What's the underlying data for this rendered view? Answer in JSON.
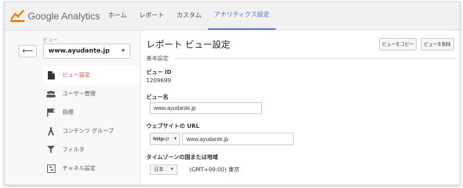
{
  "app": {
    "logo_text": "Google Analytics",
    "brand_color": "#f57c00"
  },
  "nav": {
    "items": [
      {
        "label": "ホーム"
      },
      {
        "label": "レポート"
      },
      {
        "label": "カスタム"
      },
      {
        "label": "アナリティクス設定"
      }
    ],
    "active_index": 3,
    "active_color": "#4a6bd4"
  },
  "sidebar": {
    "back_icon": "⟵",
    "view_label": "ビュー",
    "view_selected": "www.ayudante.jp",
    "items": [
      {
        "label": "ビュー設定",
        "icon": "document-icon"
      },
      {
        "label": "ユーザー管理",
        "icon": "users-icon"
      },
      {
        "label": "目標",
        "icon": "flag-icon"
      },
      {
        "label": "コンテンツ グループ",
        "icon": "person-walk-icon"
      },
      {
        "label": "フィルタ",
        "icon": "filter-icon"
      },
      {
        "label": "チャネル設定",
        "icon": "channel-icon"
      }
    ],
    "active_index": 0,
    "active_color": "#dd4b39"
  },
  "main": {
    "title": "レポート ビュー設定",
    "copy_button": "ビューをコピー",
    "delete_button": "ビューを削除",
    "section_title": "基本設定",
    "view_id_label": "ビュー ID",
    "view_id_value": "1209699",
    "view_name_label": "ビュー名",
    "view_name_value": "www.ayudante.jp",
    "website_url_label": "ウェブサイトの URL",
    "protocol_value": "http://",
    "website_url_value": "www.ayudante.jp",
    "timezone_label": "タイムゾーンの国または地域",
    "country_value": "日本",
    "timezone_value": "(GMT+09:00) 東京"
  }
}
